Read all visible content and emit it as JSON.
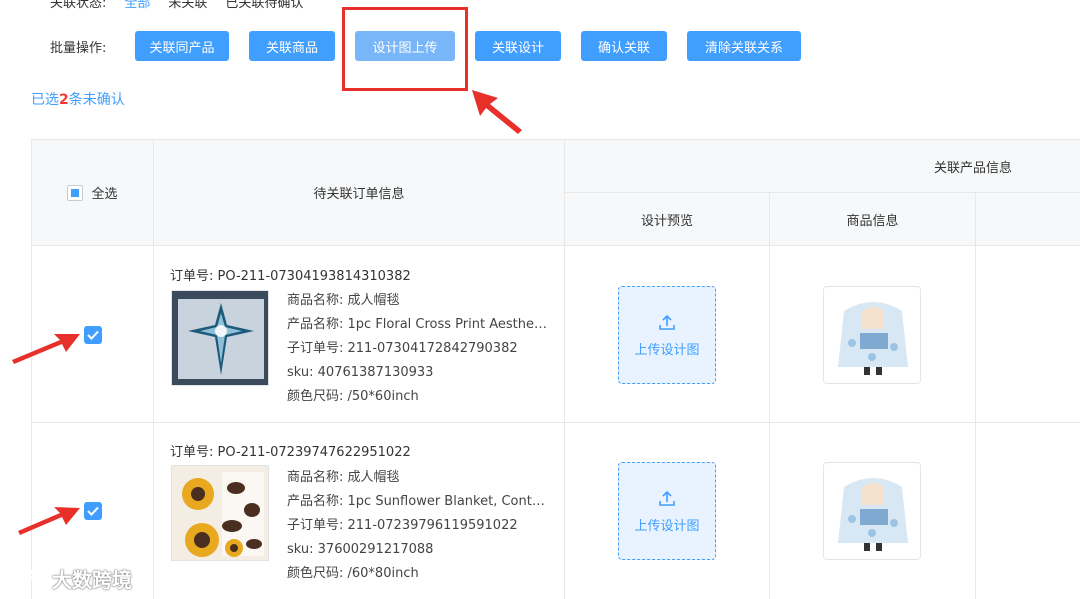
{
  "filter": {
    "label": "关联状态:",
    "options": [
      "全部",
      "未关联",
      "已关联待确认"
    ]
  },
  "batch": {
    "label": "批量操作:",
    "buttons": [
      "关联同产品",
      "关联商品",
      "设计图上传",
      "关联设计",
      "确认关联",
      "清除关联关系"
    ]
  },
  "selection": {
    "prefix": "已选",
    "count": "2",
    "suffix": "条未确认"
  },
  "table": {
    "select_all": "全选",
    "col_order": "待关联订单信息",
    "col_group": "关联产品信息",
    "col_design": "设计预览",
    "col_product": "商品信息",
    "upload_label": "上传设计图",
    "rows": [
      {
        "order_no": "订单号: PO-211-07304193814310382",
        "goods_name": "商品名称: 成人帽毯",
        "product_name": "产品名称: 1pc Floral Cross Print Aesthet...",
        "sub_order": "子订单号: 211-07304172842790382",
        "sku": "sku: 40761387130933",
        "size": "颜色尺码: /50*60inch"
      },
      {
        "order_no": "订单号: PO-211-07239747622951022",
        "goods_name": "商品名称: 成人帽毯",
        "product_name": "产品名称: 1pc Sunflower Blanket, Conte...",
        "sub_order": "子订单号: 211-07239796119591022",
        "sku": "sku: 37600291217088",
        "size": "颜色尺码: /60*80inch"
      }
    ]
  },
  "watermark": "大数跨境",
  "colors": {
    "primary": "#409eff",
    "annotation_red": "#e8302a"
  }
}
